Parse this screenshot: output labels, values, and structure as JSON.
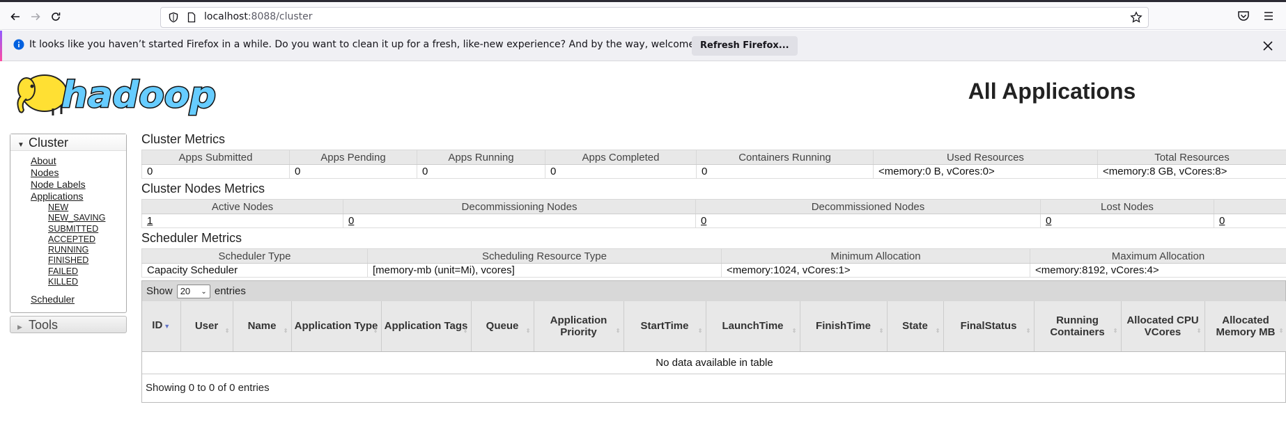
{
  "browser": {
    "url_host": "localhost",
    "url_rest": ":8088/cluster",
    "notification": "It looks like you haven’t started Firefox in a while. Do you want to clean it up for a fresh, like-new experience? And by the way, welcome back!",
    "refresh_button": "Refresh Firefox..."
  },
  "page": {
    "title": "All Applications",
    "logo_text": "hadoop"
  },
  "sidebar": {
    "cluster_header": "Cluster",
    "links": [
      "About",
      "Nodes",
      "Node Labels",
      "Applications"
    ],
    "app_states": [
      "NEW",
      "NEW_SAVING",
      "SUBMITTED",
      "ACCEPTED",
      "RUNNING",
      "FINISHED",
      "FAILED",
      "KILLED"
    ],
    "scheduler": "Scheduler",
    "tools_header": "Tools"
  },
  "cluster_metrics": {
    "title": "Cluster Metrics",
    "headers": [
      "Apps Submitted",
      "Apps Pending",
      "Apps Running",
      "Apps Completed",
      "Containers Running",
      "Used Resources",
      "Total Resources"
    ],
    "values": [
      "0",
      "0",
      "0",
      "0",
      "0",
      "<memory:0 B, vCores:0>",
      "<memory:8 GB, vCores:8>"
    ]
  },
  "node_metrics": {
    "title": "Cluster Nodes Metrics",
    "headers": [
      "Active Nodes",
      "Decommissioning Nodes",
      "Decommissioned Nodes",
      "Lost Nodes",
      ""
    ],
    "values": [
      "1",
      "0",
      "0",
      "0",
      "0"
    ]
  },
  "scheduler_metrics": {
    "title": "Scheduler Metrics",
    "headers": [
      "Scheduler Type",
      "Scheduling Resource Type",
      "Minimum Allocation",
      "Maximum Allocation"
    ],
    "values": [
      "Capacity Scheduler",
      "[memory-mb (unit=Mi), vcores]",
      "<memory:1024, vCores:1>",
      "<memory:8192, vCores:4>"
    ]
  },
  "apps_table": {
    "show_label": "Show",
    "page_size": "20",
    "entries_label": "entries",
    "columns": [
      "ID",
      "User",
      "Name",
      "Application Type",
      "Application Tags",
      "Queue",
      "Application Priority",
      "StartTime",
      "LaunchTime",
      "FinishTime",
      "State",
      "FinalStatus",
      "Running Containers",
      "Allocated CPU VCores",
      "Allocated Memory MB"
    ],
    "empty_message": "No data available in table",
    "footer": "Showing 0 to 0 of 0 entries"
  },
  "colors": {
    "logo_blue": "#66ccff",
    "logo_yellow": "#ffe033",
    "header_bg": "#e8e8e8",
    "sort_active": "#5f72c6"
  }
}
